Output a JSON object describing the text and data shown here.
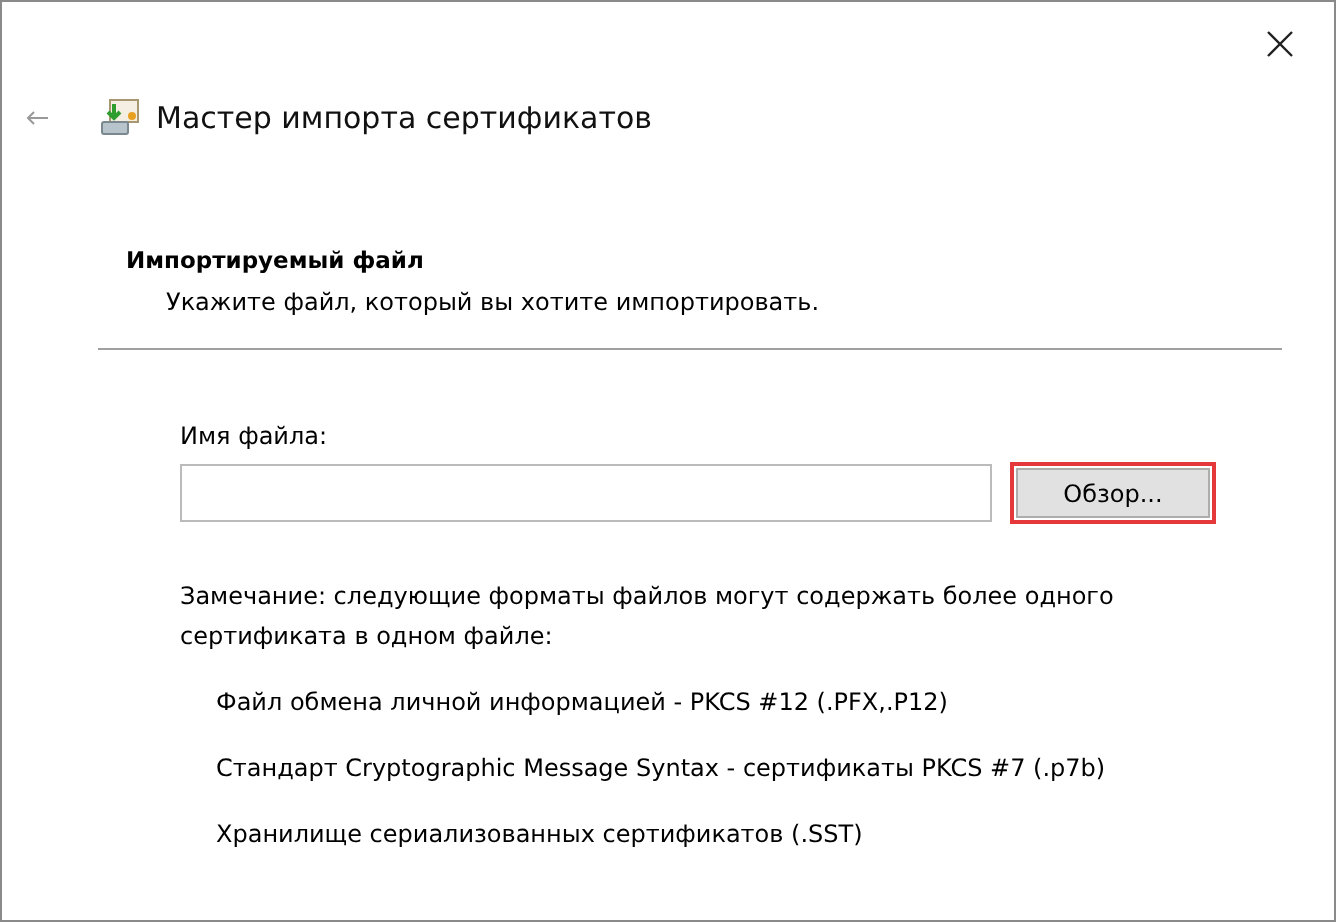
{
  "window": {
    "title": "Мастер импорта сертификатов"
  },
  "header": {
    "title": "Импортируемый файл",
    "subtitle": "Укажите файл, который вы хотите импортировать."
  },
  "file_field": {
    "label": "Имя файла:"
  },
  "browse_button": {
    "label": "Обзор...",
    "highlighted": true
  },
  "note": "Замечание: следующие форматы файлов могут содержать более одного сертификата в одном файле:",
  "formats": [
    "Файл обмена личной информацией - PKCS #12 (.PFX,.P12)",
    "Стандарт Cryptographic Message Syntax - сертификаты PKCS #7 (.p7b)",
    "Хранилище сериализованных сертификатов (.SST)"
  ]
}
